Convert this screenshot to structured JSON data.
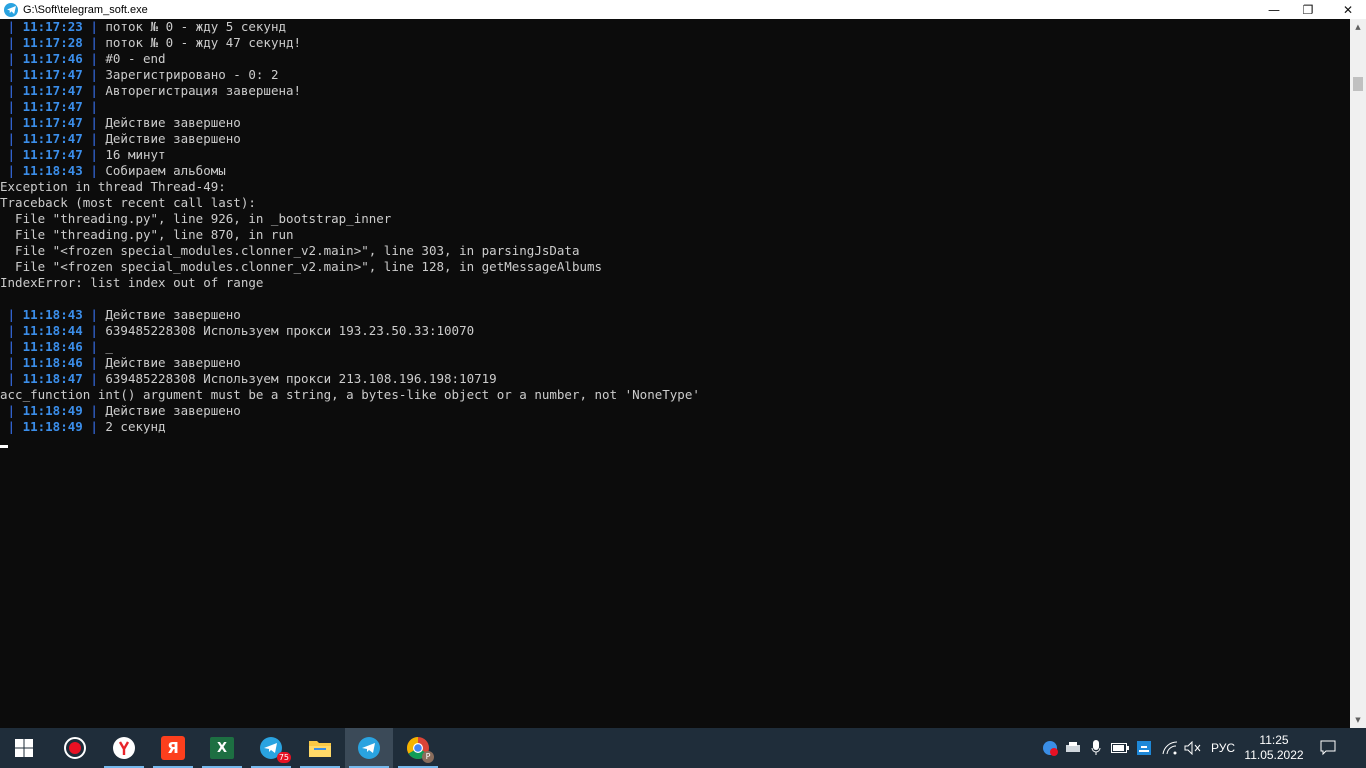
{
  "window": {
    "title": "G:\\Soft\\telegram_soft.exe",
    "minimize": "—",
    "restore": "❐",
    "close": "✕"
  },
  "console": {
    "lines": [
      {
        "ts": "11:17:23",
        "msg": "поток № 0 - жду 5 секунд"
      },
      {
        "ts": "11:17:28",
        "msg": "поток № 0 - жду 47 секунд!"
      },
      {
        "ts": "11:17:46",
        "msg": "#0 - end"
      },
      {
        "ts": "11:17:47",
        "msg": "Зарегистрировано - 0: 2"
      },
      {
        "ts": "11:17:47",
        "msg": "Авторегистрация завершена!"
      },
      {
        "ts": "11:17:47",
        "msg": ""
      },
      {
        "ts": "11:17:47",
        "msg": "Действие завершено"
      },
      {
        "ts": "11:17:47",
        "msg": "Действие завершено"
      },
      {
        "ts": "11:17:47",
        "msg": "16 минут"
      },
      {
        "ts": "11:18:43",
        "msg": "Собираем альбомы"
      },
      {
        "text": "Exception in thread Thread-49:"
      },
      {
        "text": "Traceback (most recent call last):"
      },
      {
        "text": "  File \"threading.py\", line 926, in _bootstrap_inner"
      },
      {
        "text": "  File \"threading.py\", line 870, in run"
      },
      {
        "text": "  File \"<frozen special_modules.clonner_v2.main>\", line 303, in parsingJsData"
      },
      {
        "text": "  File \"<frozen special_modules.clonner_v2.main>\", line 128, in getMessageAlbums"
      },
      {
        "text": "IndexError: list index out of range"
      },
      {
        "text": ""
      },
      {
        "ts": "11:18:43",
        "msg": "Действие завершено"
      },
      {
        "ts": "11:18:44",
        "msg": "639485228308 Используем прокси 193.23.50.33:10070"
      },
      {
        "ts": "11:18:46",
        "msg": "_"
      },
      {
        "ts": "11:18:46",
        "msg": "Действие завершено"
      },
      {
        "ts": "11:18:47",
        "msg": "639485228308 Используем прокси 213.108.196.198:10719"
      },
      {
        "text": "acc_function int() argument must be a string, a bytes-like object or a number, not 'NoneType'"
      },
      {
        "ts": "11:18:49",
        "msg": "Действие завершено"
      },
      {
        "ts": "11:18:49",
        "msg": "2 секунд"
      }
    ],
    "pipe": "|"
  },
  "colors": {
    "console_bg": "#0c0c0c",
    "timestamp": "#3b8eea",
    "text": "#cccccc",
    "taskbar_bg": "#1f2d3a"
  },
  "taskbar": {
    "apps": [
      {
        "name": "start-button",
        "icon": "windows-logo-icon"
      },
      {
        "name": "taskbar-recorder",
        "icon": "record-icon"
      },
      {
        "name": "taskbar-yandex-browser",
        "icon": "yandex-browser-icon"
      },
      {
        "name": "taskbar-yandex",
        "icon": "yandex-icon",
        "glyph": "Я"
      },
      {
        "name": "taskbar-excel",
        "icon": "excel-icon",
        "glyph": "X"
      },
      {
        "name": "taskbar-telegram-1",
        "icon": "telegram-icon",
        "badge": "75"
      },
      {
        "name": "taskbar-file-explorer",
        "icon": "folder-icon"
      },
      {
        "name": "taskbar-telegram-soft",
        "icon": "telegram-icon"
      },
      {
        "name": "taskbar-chrome",
        "icon": "chrome-icon",
        "glyph": "P"
      }
    ],
    "language": "РУС",
    "time": "11:25",
    "date": "11.05.2022"
  }
}
